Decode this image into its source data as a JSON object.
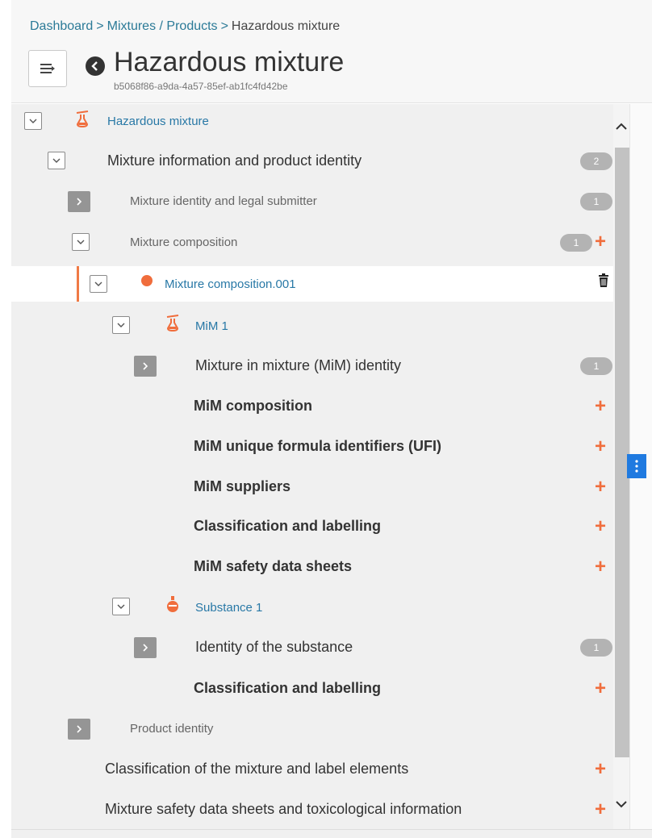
{
  "breadcrumb": {
    "items": [
      "Dashboard",
      "Mixtures / Products",
      "Hazardous mixture"
    ],
    "separator": ">"
  },
  "header": {
    "title": "Hazardous mixture",
    "uuid": "b5068f86-a9da-4a57-85ef-ab1fc4fd42be"
  },
  "tree": {
    "root": {
      "label": "Hazardous mixture",
      "icon": "mixture-flask-icon"
    },
    "section1": {
      "label": "Mixture information and product identity",
      "count": "2"
    },
    "mixture_identity": {
      "label": "Mixture identity and legal submitter",
      "count": "1"
    },
    "mixture_composition": {
      "label": "Mixture composition",
      "count": "1"
    },
    "composition_item": {
      "label": "Mixture composition.001"
    },
    "mim": {
      "label": "MiM 1"
    },
    "mim_identity": {
      "label": "Mixture in mixture (MiM) identity",
      "count": "1"
    },
    "mim_composition": {
      "label": "MiM composition"
    },
    "mim_ufi": {
      "label": "MiM unique formula identifiers (UFI)"
    },
    "mim_suppliers": {
      "label": "MiM suppliers"
    },
    "mim_classification": {
      "label": "Classification and labelling"
    },
    "mim_sds": {
      "label": "MiM safety data sheets"
    },
    "substance": {
      "label": "Substance 1"
    },
    "substance_identity": {
      "label": "Identity of the substance",
      "count": "1"
    },
    "substance_classification": {
      "label": "Classification and labelling"
    },
    "product_identity": {
      "label": "Product identity"
    },
    "classification_mixture": {
      "label": "Classification of the mixture and label elements"
    },
    "mixture_sds": {
      "label": "Mixture safety data sheets and toxicological information"
    }
  },
  "colors": {
    "accent": "#f06d3c",
    "link": "#2878a6",
    "handle": "#1f7ae0",
    "badge": "#b3b3b3"
  }
}
